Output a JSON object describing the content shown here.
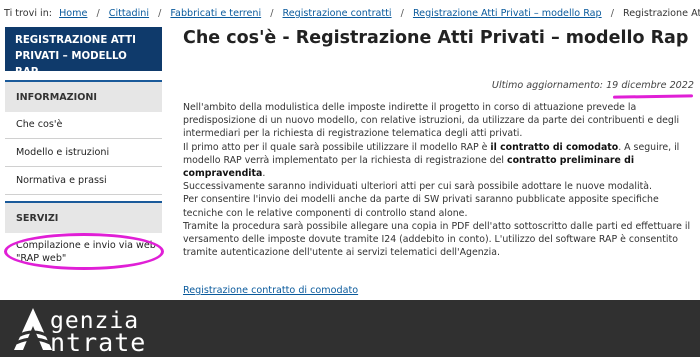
{
  "breadcrumb": {
    "prefix": "Ti trovi in:",
    "items": [
      "Home",
      "Cittadini",
      "Fabbricati e terreni",
      "Registrazione contratti",
      "Registrazione Atti Privati – modello Rap"
    ],
    "current": "Registrazione Atti Privati – modello Rap",
    "separator": "/"
  },
  "sidebar": {
    "header_line1": "REGISTRAZIONE ATTI",
    "header_line2": "PRIVATI – MODELLO RAP",
    "section_info": "INFORMAZIONI",
    "info_items": [
      "Che cos'è",
      "Modello e istruzioni",
      "Normativa e prassi"
    ],
    "section_services": "SERVIZI",
    "service_line1": "Compilazione e invio via web",
    "service_line2": "\"RAP web\""
  },
  "main": {
    "title": "Che cos'è - Registrazione Atti Privati – modello Rap",
    "updated_label": "Ultimo aggiornamento:",
    "updated_date": "19 dicembre 2022",
    "p1": "Nell'ambito della modulistica delle imposte indirette il progetto in corso di attuazione prevede la predisposizione di un nuovo modello, con relative istruzioni, da utilizzare da parte dei contribuenti e degli intermediari per la richiesta di registrazione telematica degli atti privati.",
    "p2a": "Il primo atto per il quale sarà possibile utilizzare il modello RAP è ",
    "p2b": "il contratto di comodato",
    "p2c": ". A seguire, il modello RAP verrà implementato per la richiesta di registrazione del ",
    "p2d": "contratto preliminare di compravendita",
    "p2e": ".",
    "p3": "Successivamente saranno individuati ulteriori atti per cui sarà possibile adottare le nuove modalità.",
    "p4": "Per consentire l'invio dei modelli anche da parte di SW privati saranno pubblicate apposite specifiche tecniche con le relative componenti di controllo stand alone.",
    "p5": "Tramite la procedura sarà possibile allegare una copia in PDF dell'atto sottoscritto dalle parti ed effettuare il versamento delle imposte dovute tramite I24 (addebito in conto). L'utilizzo del software RAP è consentito tramite autenticazione dell'utente ai servizi telematici dell'Agenzia.",
    "link": "Registrazione contratto di comodato"
  },
  "footer": {
    "logo_line1": "genzia",
    "logo_line2": "ntrate"
  },
  "colors": {
    "sidebar_header": "#0f3a6b",
    "link": "#0a5a9c",
    "annotation": "#e01fd6",
    "footer": "#303030"
  }
}
